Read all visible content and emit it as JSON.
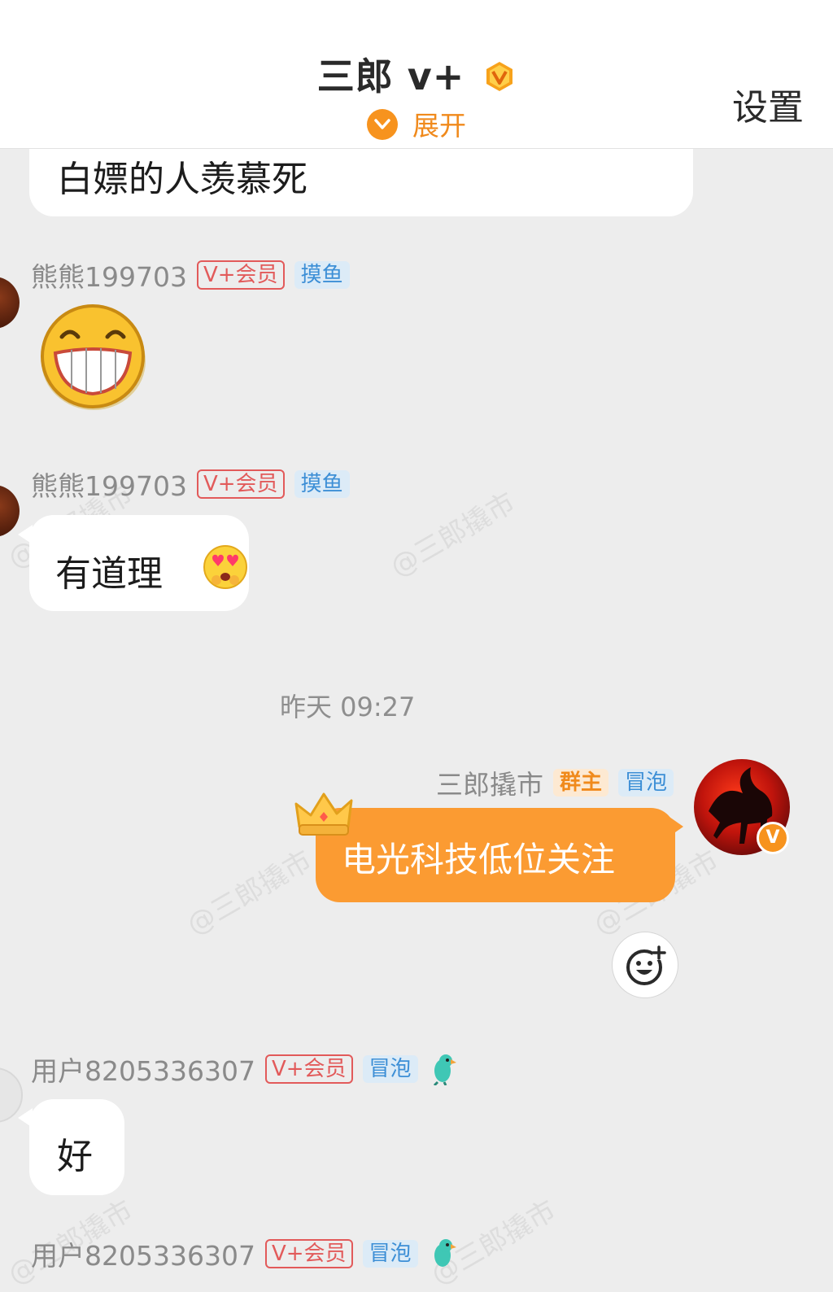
{
  "header": {
    "title": "三郎 v+",
    "expand_label": "展开",
    "settings_label": "设置"
  },
  "messages": [
    {
      "text": "白嫖的人羡慕死"
    },
    {
      "sender": "熊熊199703",
      "badges": [
        "V+会员",
        "摸鱼"
      ],
      "emoji": "grin-emoji"
    },
    {
      "sender": "熊熊199703",
      "badges": [
        "V+会员",
        "摸鱼"
      ],
      "text": "有道理"
    },
    {
      "timestamp": "昨天 09:27"
    },
    {
      "sender": "三郎撬市",
      "badges": [
        "群主",
        "冒泡"
      ],
      "text": "电光科技低位关注",
      "self": true
    },
    {
      "sender": "用户8205336307",
      "badges": [
        "V+会员",
        "冒泡"
      ],
      "text": "好"
    },
    {
      "sender": "用户8205336307",
      "badges": [
        "V+会员",
        "冒泡"
      ]
    }
  ],
  "watermark": "@三郎撬市",
  "colors": {
    "accent": "#f7931e",
    "my_bubble": "#fb9b32",
    "vip_tag": "#e25a5a",
    "blue_tag": "#3d8fd6"
  }
}
